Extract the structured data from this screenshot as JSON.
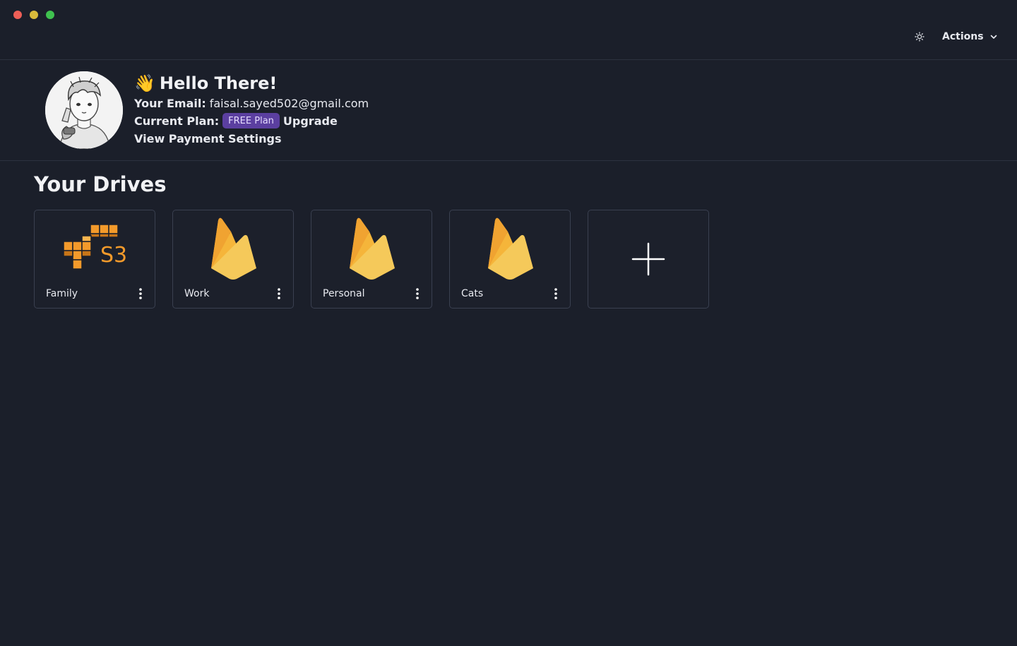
{
  "window": {
    "controls": [
      "close",
      "minimize",
      "maximize"
    ]
  },
  "header": {
    "theme_icon": "sun-icon",
    "actions_label": "Actions"
  },
  "profile": {
    "greeting_emoji": "👋",
    "greeting": "Hello There!",
    "email_label": "Your Email:",
    "email": "faisal.sayed502@gmail.com",
    "plan_label": "Current Plan:",
    "plan_badge": "FREE Plan",
    "upgrade_label": "Upgrade",
    "payment_link": "View Payment Settings"
  },
  "drives_section": {
    "title": "Your Drives",
    "drives": [
      {
        "name": "Family",
        "provider_icon": "aws-s3-icon"
      },
      {
        "name": "Work",
        "provider_icon": "firebase-icon"
      },
      {
        "name": "Personal",
        "provider_icon": "firebase-icon"
      },
      {
        "name": "Cats",
        "provider_icon": "firebase-icon"
      }
    ],
    "add_icon": "plus-icon"
  },
  "colors": {
    "background": "#1b1f2a",
    "border": "#2c323f",
    "badge": "#5b3fa0",
    "firebase_yellow": "#f5c95a",
    "firebase_orange": "#f29a2a",
    "s3_orange": "#f39a2b"
  }
}
